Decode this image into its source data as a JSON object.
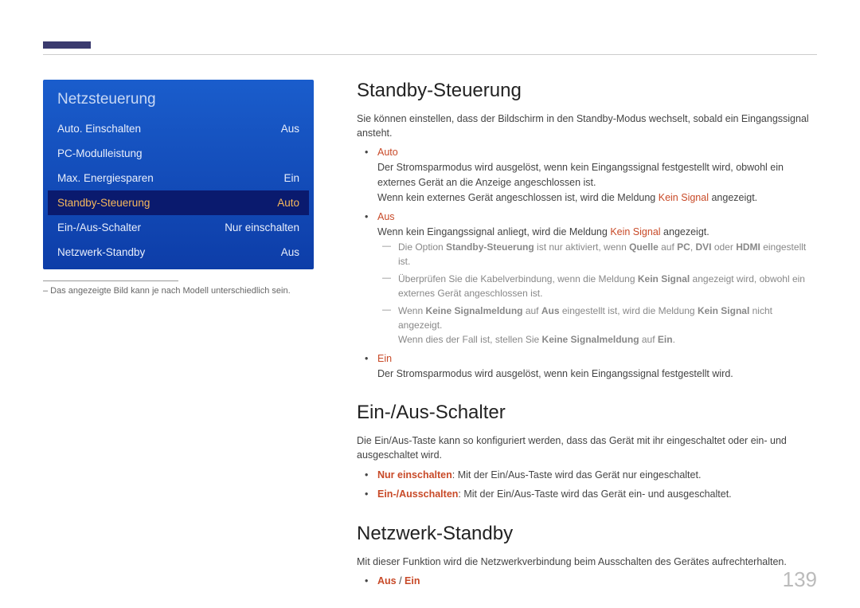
{
  "menu": {
    "title": "Netzsteuerung",
    "items": [
      {
        "label": "Auto. Einschalten",
        "value": "Aus",
        "selected": false
      },
      {
        "label": "PC-Modulleistung",
        "value": "",
        "selected": false
      },
      {
        "label": "Max. Energiesparen",
        "value": "Ein",
        "selected": false
      },
      {
        "label": "Standby-Steuerung",
        "value": "Auto",
        "selected": true
      },
      {
        "label": "Ein-/Aus-Schalter",
        "value": "Nur einschalten",
        "selected": false
      },
      {
        "label": "Netzwerk-Standby",
        "value": "Aus",
        "selected": false
      }
    ],
    "footnote": "– Das angezeigte Bild kann je nach Modell unterschiedlich sein."
  },
  "sections": {
    "standby": {
      "title": "Standby-Steuerung",
      "intro": "Sie können einstellen, dass der Bildschirm in den Standby-Modus wechselt, sobald ein Eingangssignal ansteht.",
      "auto": {
        "head": "Auto",
        "p1": "Der Stromsparmodus wird ausgelöst, wenn kein Eingangssignal festgestellt wird, obwohl ein externes Gerät an die Anzeige angeschlossen ist.",
        "p2_pre": "Wenn kein externes Gerät angeschlossen ist, wird die Meldung ",
        "p2_hl": "Kein Signal",
        "p2_post": " angezeigt."
      },
      "aus": {
        "head": "Aus",
        "p1_pre": "Wenn kein Eingangssignal anliegt, wird die Meldung ",
        "p1_hl": "Kein Signal",
        "p1_post": " angezeigt.",
        "notes": [
          {
            "t0": "Die Option ",
            "h1": "Standby-Steuerung",
            "t1": " ist nur aktiviert, wenn ",
            "h2": "Quelle",
            "t2": " auf ",
            "h3": "PC",
            "t3": ", ",
            "h4": "DVI",
            "t4": " oder ",
            "h5": "HDMI",
            "t5": " eingestellt ist."
          },
          {
            "t0": "Überprüfen Sie die Kabelverbindung, wenn die Meldung ",
            "h1": "Kein Signal",
            "t1": " angezeigt wird, obwohl ein externes Gerät angeschlossen ist."
          },
          {
            "t0": "Wenn ",
            "h1": "Keine Signalmeldung",
            "t1": " auf ",
            "h2": "Aus",
            "t2": " eingestellt ist, wird die Meldung ",
            "h3": "Kein Signal",
            "t3": " nicht angezeigt.",
            "l2_t0": "Wenn dies der Fall ist, stellen Sie ",
            "l2_h1": "Keine Signalmeldung",
            "l2_t1": " auf ",
            "l2_h2": "Ein",
            "l2_t2": "."
          }
        ]
      },
      "ein": {
        "head": "Ein",
        "p1": "Der Stromsparmodus wird ausgelöst, wenn kein Eingangssignal festgestellt wird."
      }
    },
    "power": {
      "title": "Ein-/Aus-Schalter",
      "intro": "Die Ein/Aus-Taste kann so konfiguriert werden, dass das Gerät mit ihr eingeschaltet oder ein- und ausgeschaltet wird.",
      "opt1": {
        "head": "Nur einschalten",
        "text": ": Mit der Ein/Aus-Taste wird das Gerät nur eingeschaltet."
      },
      "opt2": {
        "head": "Ein-/Ausschalten",
        "text": ": Mit der Ein/Aus-Taste wird das Gerät ein- und ausgeschaltet."
      }
    },
    "network": {
      "title": "Netzwerk-Standby",
      "intro": "Mit dieser Funktion wird die Netzwerkverbindung beim Ausschalten des Gerätes aufrechterhalten.",
      "opt": {
        "aus": "Aus",
        "sep": " / ",
        "ein": "Ein"
      }
    }
  },
  "page_number": "139"
}
